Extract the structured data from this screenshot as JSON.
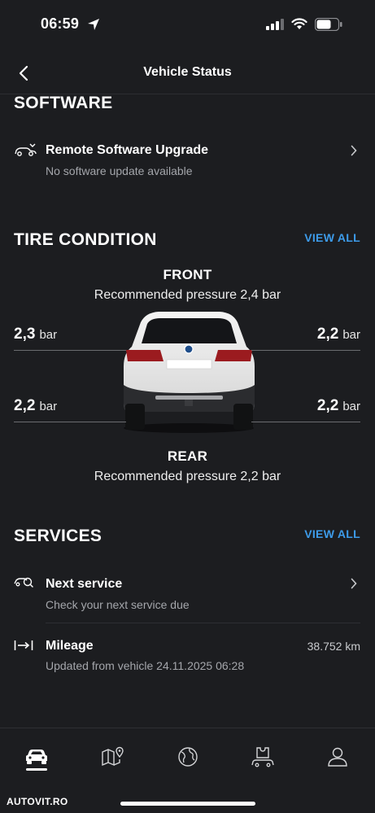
{
  "status_bar": {
    "time": "06:59"
  },
  "nav": {
    "title": "Vehicle Status"
  },
  "software": {
    "section_title": "SOFTWARE",
    "item": {
      "title": "Remote Software Upgrade",
      "subtitle": "No software update available"
    }
  },
  "tires": {
    "section_title": "TIRE CONDITION",
    "view_all": "VIEW ALL",
    "front_label": "FRONT",
    "front_recommended": "Recommended pressure 2,4 bar",
    "rear_label": "REAR",
    "rear_recommended": "Recommended pressure 2,2 bar",
    "unit": "bar",
    "front_left": "2,3",
    "front_right": "2,2",
    "rear_left": "2,2",
    "rear_right": "2,2"
  },
  "services": {
    "section_title": "SERVICES",
    "view_all": "VIEW ALL",
    "next_service": {
      "title": "Next service",
      "subtitle": "Check your next service due"
    },
    "mileage": {
      "title": "Mileage",
      "subtitle": "Updated from vehicle 24.11.2025 06:28",
      "value": "38.752 km"
    }
  },
  "tabbar": {
    "tabs": [
      {
        "icon": "car-icon",
        "active": true
      },
      {
        "icon": "map-icon",
        "active": false
      },
      {
        "icon": "globe-icon",
        "active": false
      },
      {
        "icon": "car-service-icon",
        "active": false
      },
      {
        "icon": "profile-icon",
        "active": false
      }
    ]
  },
  "watermark": "AUTOVIT.RO",
  "colors": {
    "background": "#1c1d20",
    "accent": "#3d9be9",
    "text": "#ffffff",
    "muted": "#a4a6ab"
  }
}
